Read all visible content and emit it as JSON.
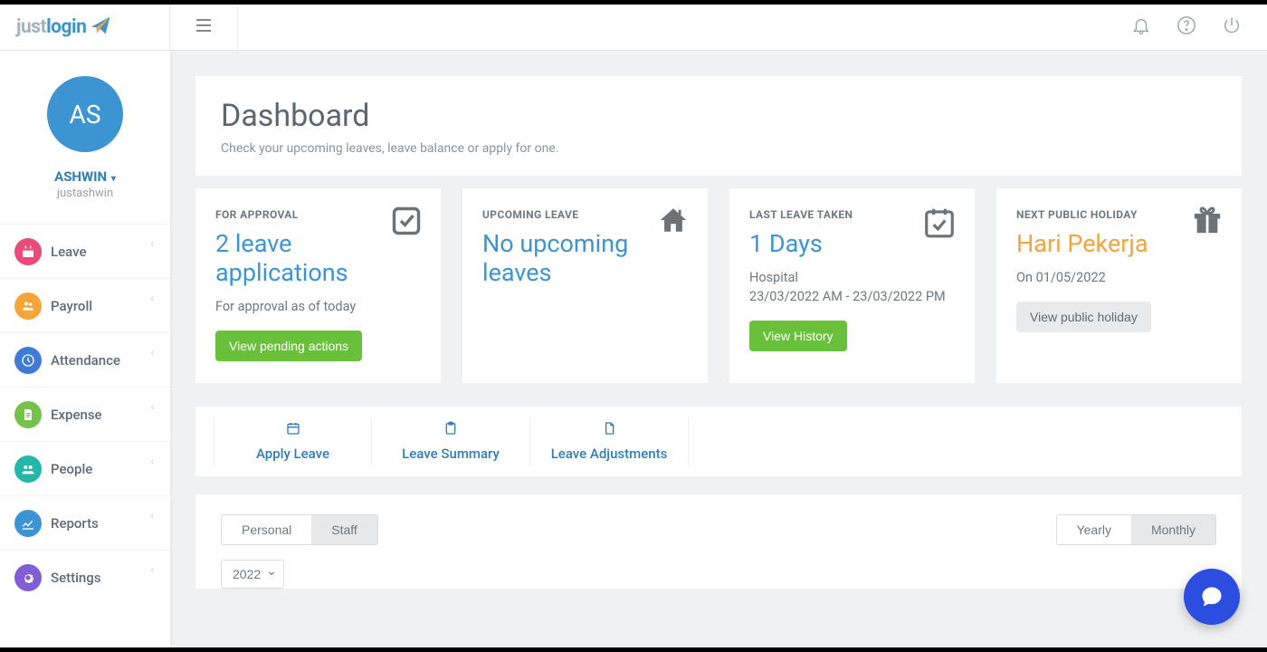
{
  "brand": {
    "part1": "just",
    "part2": "login"
  },
  "user": {
    "initials": "AS",
    "name": "ASHWIN",
    "subname": "justashwin"
  },
  "sidebar": {
    "items": [
      {
        "label": "Leave",
        "color": "#ec4a7a",
        "icon": "calendar"
      },
      {
        "label": "Payroll",
        "color": "#f5a53a",
        "icon": "people"
      },
      {
        "label": "Attendance",
        "color": "#3f7bd6",
        "icon": "clock"
      },
      {
        "label": "Expense",
        "color": "#74c24b",
        "icon": "doc"
      },
      {
        "label": "People",
        "color": "#24b6a8",
        "icon": "group"
      },
      {
        "label": "Reports",
        "color": "#3c95d2",
        "icon": "chart"
      },
      {
        "label": "Settings",
        "color": "#7f5ed6",
        "icon": "gear"
      }
    ]
  },
  "header": {
    "title": "Dashboard",
    "subtitle": "Check your upcoming leaves, leave balance or apply for one."
  },
  "cards": {
    "approval": {
      "label": "FOR APPROVAL",
      "value": "2 leave applications",
      "sub": "For approval as of today",
      "button": "View pending actions"
    },
    "upcoming": {
      "label": "UPCOMING LEAVE",
      "value": "No upcoming leaves"
    },
    "last": {
      "label": "LAST LEAVE TAKEN",
      "value": "1 Days",
      "sub1": "Hospital",
      "sub2": "23/03/2022 AM - 23/03/2022 PM",
      "button": "View History"
    },
    "holiday": {
      "label": "NEXT PUBLIC HOLIDAY",
      "value": "Hari Pekerja",
      "sub": "On 01/05/2022",
      "button": "View public holiday"
    }
  },
  "actions": {
    "apply": "Apply Leave",
    "summary": "Leave Summary",
    "adjust": "Leave Adjustments"
  },
  "tabs": {
    "personal": "Personal",
    "staff": "Staff",
    "yearly": "Yearly",
    "monthly": "Monthly",
    "year": "2022"
  }
}
